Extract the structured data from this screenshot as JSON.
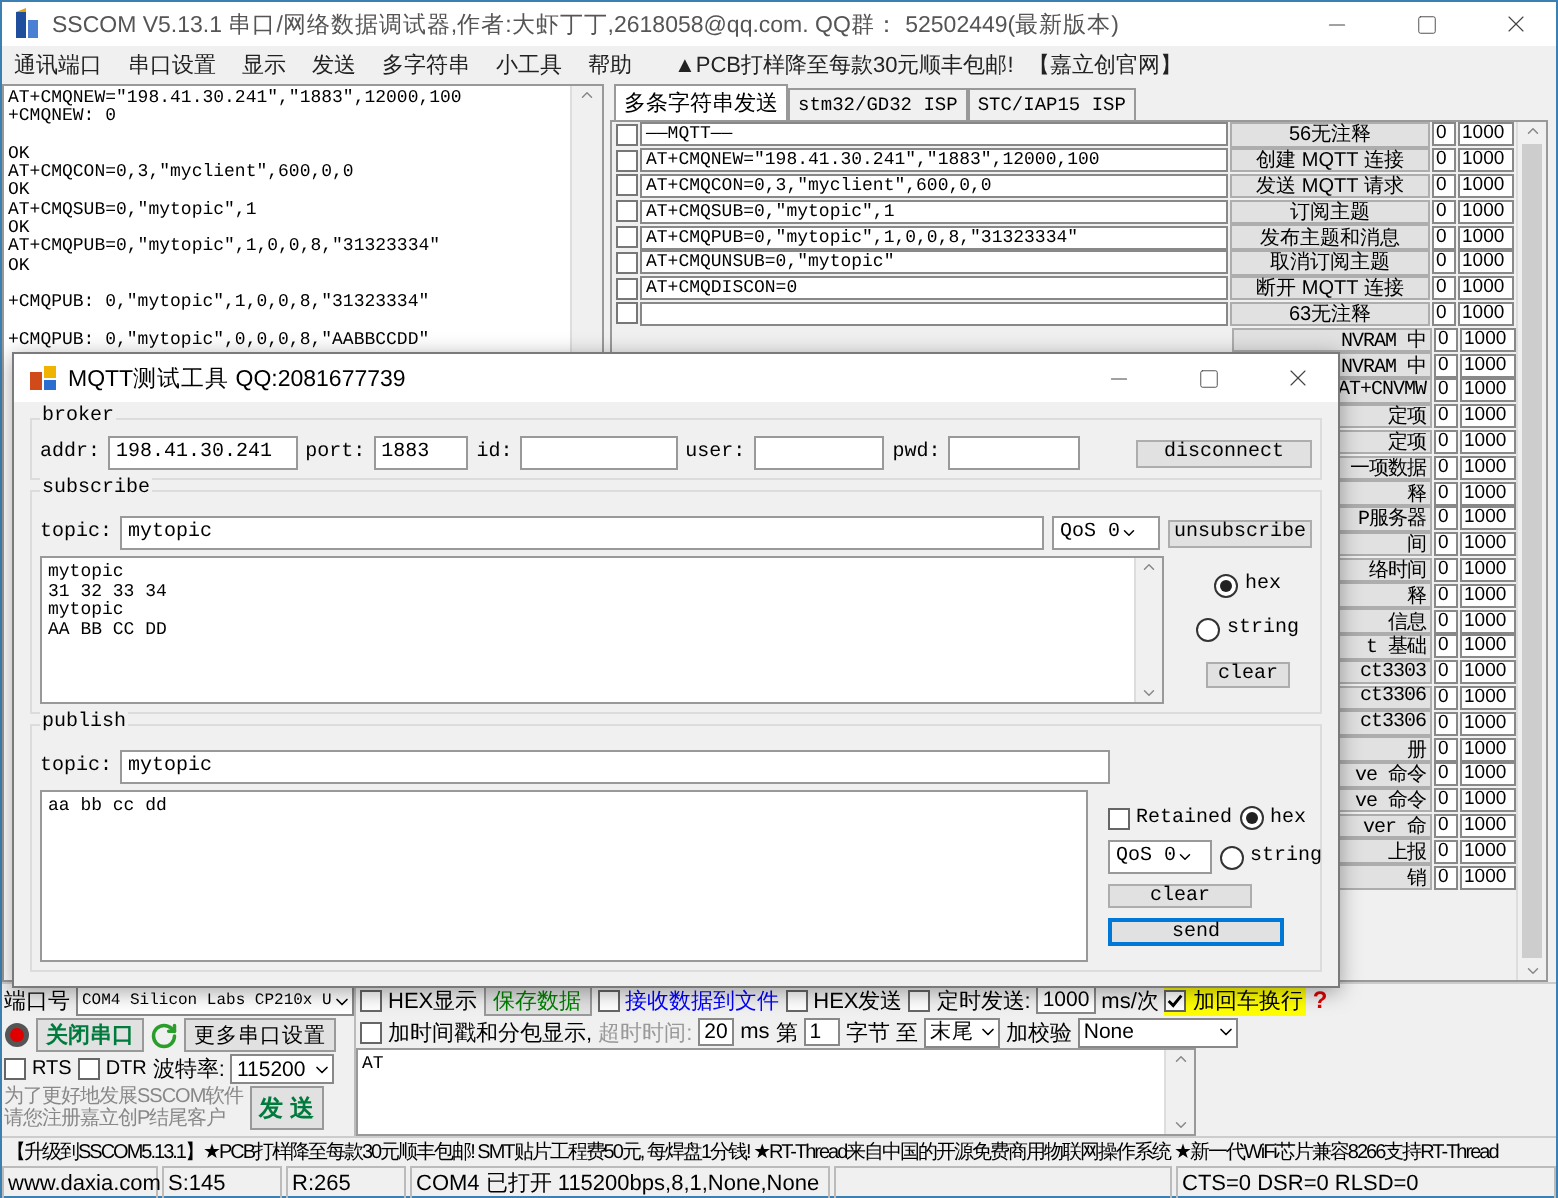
{
  "window": {
    "title": "SSCOM V5.13.1 串口/网络数据调试器,作者:大虾丁丁,2618058@qq.com. QQ群： 52502449(最新版本)"
  },
  "menu": [
    "通讯端口",
    "串口设置",
    "显示",
    "发送",
    "多字符串",
    "小工具",
    "帮助"
  ],
  "menu_ads": [
    "▲PCB打样降至每款30元顺丰包邮!",
    "【嘉立创官网】"
  ],
  "receive_log": "AT+CMQNEW=\"198.41.30.241\",\"1883\",12000,100\n+CMQNEW: 0\n\nOK\nAT+CMQCON=0,3,\"myclient\",600,0,0\nOK\nAT+CMQSUB=0,\"mytopic\",1\nOK\nAT+CMQPUB=0,\"mytopic\",1,0,0,8,\"31323334\"\nOK\n\n+CMQPUB: 0,\"mytopic\",1,0,0,8,\"31323334\"\n\n+CMQPUB: 0,\"mytopic\",0,0,0,8,\"AABBCCDD\"",
  "send_tabs": [
    {
      "label": "多条字符串发送",
      "selected": true
    },
    {
      "label": "stm32/GD32 ISP",
      "selected": false
    },
    {
      "label": "STC/IAP15 ISP",
      "selected": false
    }
  ],
  "commands": [
    {
      "kind": "full",
      "checked": false,
      "text": "——MQTT——",
      "label": "56无注释",
      "count": "0",
      "delay": "1000"
    },
    {
      "kind": "full",
      "checked": false,
      "text": "AT+CMQNEW=\"198.41.30.241\",\"1883\",12000,100",
      "label": "创建 MQTT 连接",
      "count": "0",
      "delay": "1000"
    },
    {
      "kind": "full",
      "checked": false,
      "text": "AT+CMQCON=0,3,\"myclient\",600,0,0",
      "label": "发送 MQTT 请求",
      "count": "0",
      "delay": "1000"
    },
    {
      "kind": "full",
      "checked": false,
      "text": "AT+CMQSUB=0,\"mytopic\",1",
      "label": "订阅主题",
      "count": "0",
      "delay": "1000"
    },
    {
      "kind": "full",
      "checked": false,
      "text": "AT+CMQPUB=0,\"mytopic\",1,0,0,8,\"31323334\"",
      "label": "发布主题和消息",
      "count": "0",
      "delay": "1000"
    },
    {
      "kind": "full",
      "checked": false,
      "text": "AT+CMQUNSUB=0,\"mytopic\"",
      "label": "取消订阅主题",
      "count": "0",
      "delay": "1000"
    },
    {
      "kind": "full",
      "checked": false,
      "text": "AT+CMQDISCON=0",
      "label": "断开 MQTT 连接",
      "count": "0",
      "delay": "1000"
    },
    {
      "kind": "full",
      "checked": false,
      "label": "63无注释",
      "count": "0",
      "delay": "1000"
    },
    {
      "kind": "partial",
      "label": "NVRAM 中",
      "count": "0",
      "delay": "1000"
    },
    {
      "kind": "partial",
      "label": "NVRAM 中",
      "count": "0",
      "delay": "1000"
    },
    {
      "kind": "partial",
      "label": "AT+CNVMW",
      "count": "0",
      "delay": "1000"
    },
    {
      "kind": "partial",
      "label": "定项",
      "count": "0",
      "delay": "1000"
    },
    {
      "kind": "partial",
      "label": "定项",
      "count": "0",
      "delay": "1000"
    },
    {
      "kind": "partial",
      "label": "一项数据",
      "count": "0",
      "delay": "1000"
    },
    {
      "kind": "partial",
      "label": "释",
      "count": "0",
      "delay": "1000"
    },
    {
      "kind": "partial",
      "label": "P服务器",
      "count": "0",
      "delay": "1000"
    },
    {
      "kind": "partial",
      "label": "间",
      "count": "0",
      "delay": "1000"
    },
    {
      "kind": "partial",
      "label": "络时间",
      "count": "0",
      "delay": "1000"
    },
    {
      "kind": "partial",
      "label": "释",
      "count": "0",
      "delay": "1000"
    },
    {
      "kind": "partial",
      "label": "信息",
      "count": "0",
      "delay": "1000"
    },
    {
      "kind": "partial",
      "label": "t 基础",
      "count": "0",
      "delay": "1000"
    },
    {
      "kind": "partial",
      "label": "ct3303",
      "count": "0",
      "delay": "1000"
    },
    {
      "kind": "partial",
      "label": "ct3306",
      "count": "0",
      "delay": "1000"
    },
    {
      "kind": "partial",
      "label": "ct3306",
      "count": "0",
      "delay": "1000"
    },
    {
      "kind": "partial",
      "label": "册",
      "count": "0",
      "delay": "1000"
    },
    {
      "kind": "partial",
      "label": "ve 命令",
      "count": "0",
      "delay": "1000"
    },
    {
      "kind": "partial",
      "label": "ve 命令",
      "count": "0",
      "delay": "1000"
    },
    {
      "kind": "partial",
      "label": "ver 命",
      "count": "0",
      "delay": "1000"
    },
    {
      "kind": "partial",
      "label": "上报",
      "count": "0",
      "delay": "1000"
    },
    {
      "kind": "partial",
      "label": "销",
      "count": "0",
      "delay": "1000"
    }
  ],
  "mqtt_tool": {
    "title": "MQTT测试工具 QQ:2081677739",
    "broker": {
      "legend": "broker",
      "fields": [
        {
          "label": "addr:",
          "value": "198.41.30.241"
        },
        {
          "label": "port:",
          "value": "1883"
        },
        {
          "label": "id:"
        },
        {
          "label": "user:"
        },
        {
          "label": "pwd:"
        }
      ],
      "button": "disconnect"
    },
    "subscribe": {
      "legend": "subscribe",
      "topic_label": "topic:",
      "topic": "mytopic",
      "qos": "QoS 0",
      "button": "unsubscribe",
      "messages": "mytopic\n31 32 33 34\nmytopic\nAA BB CC DD",
      "formats": [
        {
          "label": "hex",
          "selected": true
        },
        {
          "label": "string",
          "selected": false
        }
      ],
      "clear": "clear"
    },
    "publish": {
      "legend": "publish",
      "topic_label": "topic:",
      "topic": "mytopic",
      "payload": "aa bb cc dd",
      "retained": {
        "label": "Retained",
        "checked": false
      },
      "qos": "QoS 0",
      "formats": [
        {
          "label": "hex",
          "selected": true
        },
        {
          "label": "string",
          "selected": false
        }
      ],
      "clear": "clear",
      "send": "send"
    }
  },
  "serial": {
    "port_label": "端口号",
    "port": "COM4 Silicon Labs CP210x U",
    "open_button": "关闭串口",
    "more_button": "更多串口设置",
    "lines": [
      {
        "label": "RTS",
        "checked": false
      },
      {
        "label": "DTR",
        "checked": false
      }
    ],
    "baud_label": "波特率:",
    "baud": "115200",
    "notice": [
      "为了更好地发展SSCOM软件",
      "请您注册嘉立创P结尾客户"
    ],
    "send_button": "发 送"
  },
  "options_row_1": [
    {
      "kind": "check",
      "label": "HEX显示",
      "checked": false,
      "highlight": false
    },
    {
      "kind": "button",
      "label": "保存数据",
      "color": "#008000"
    },
    {
      "kind": "check",
      "label": "接收数据到文件",
      "checked": false,
      "highlight": false,
      "color": "#0000ff"
    },
    {
      "kind": "check",
      "label": "HEX发送",
      "checked": false,
      "highlight": false
    },
    {
      "kind": "check",
      "label": "定时发送:",
      "checked": false,
      "highlight": false
    },
    {
      "kind": "input",
      "value": "1000"
    },
    {
      "kind": "text",
      "label": "ms/次",
      "disabled": false
    },
    {
      "kind": "check",
      "label": "加回车换行",
      "checked": true,
      "highlight": true
    },
    {
      "kind": "help",
      "label": "?"
    }
  ],
  "options_row_2": [
    {
      "kind": "check",
      "label": "加时间戳和分包显示,",
      "checked": false,
      "highlight": false
    },
    {
      "kind": "text",
      "label": "超时时间:",
      "disabled": true
    },
    {
      "kind": "input",
      "value": "20"
    },
    {
      "kind": "text",
      "label": "ms",
      "disabled": false
    },
    {
      "kind": "text",
      "label": "第",
      "disabled": false
    },
    {
      "kind": "input",
      "value": "1"
    },
    {
      "kind": "text",
      "label": "字节 至",
      "disabled": false
    },
    {
      "kind": "select",
      "value": "末尾"
    },
    {
      "kind": "text",
      "label": "加校验",
      "disabled": false
    },
    {
      "kind": "select",
      "value": "None"
    }
  ],
  "send_text": "AT",
  "marquee": "【升级到SSCOM5.13.1】★PCB打样降至每款30元顺丰包邮! SMT贴片工程费50元, 每焊盘1分钱! ★RT-Thread来自中国的开源免费商用物联网操作系统 ★新一代WiFi芯片兼容8266支持RT-Thread",
  "status_bar": [
    "www.daxia.com",
    "S:145",
    "R:265",
    "COM4 已打开  115200bps,8,1,None,None",
    "CTS=0 DSR=0 RLSD=0"
  ]
}
